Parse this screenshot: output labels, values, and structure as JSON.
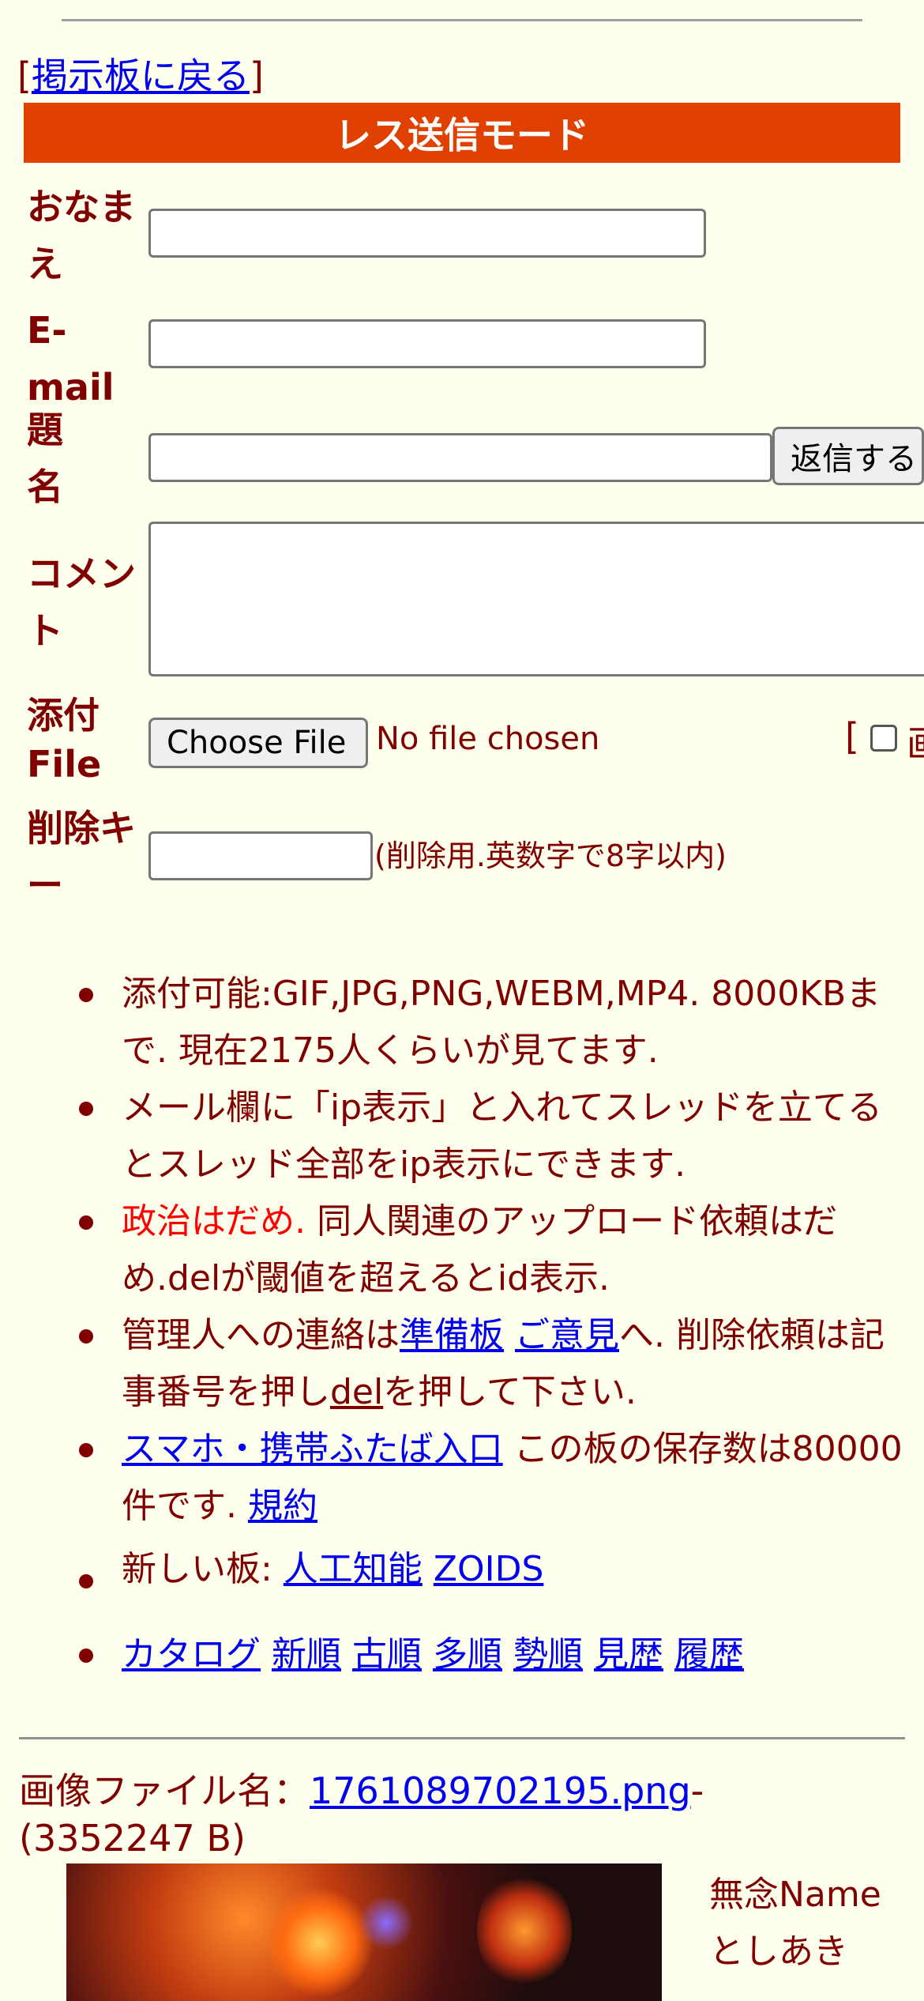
{
  "nav": {
    "bracket_open": "[",
    "back_label": "掲示板に戻る",
    "bracket_close": "]"
  },
  "form": {
    "title": "レス送信モード",
    "name_label": "おなまえ",
    "email_label": "E-mail",
    "subject_label": "題名",
    "submit_label": "返信する",
    "comment_label": "コメント",
    "file_label": "添付File",
    "choose_file_label": "Choose File",
    "no_file_text": "No file chosen",
    "file_option_bracket": "[",
    "file_option_label": "画",
    "delete_key_label": "削除キー",
    "delete_key_hint": "(削除用.英数字で8字以内)",
    "name_value": "",
    "email_value": "",
    "subject_value": "",
    "comment_value": "",
    "delete_key_value": ""
  },
  "rules": {
    "item1": "添付可能:GIF,JPG,PNG,WEBM,MP4. 8000KBまで. 現在2175人くらいが見てます.",
    "item2": "メール欄に「ip表示」と入れてスレッドを立てるとスレッド全部をip表示にできます.",
    "item3_red": "政治はだめ.",
    "item3_rest": " 同人関連のアップロード依頼はだめ.delが閾値を超えるとid表示.",
    "item4_a": "管理人への連絡は",
    "item4_link1": "準備板",
    "item4_link2": "ご意見",
    "item4_b": "へ. 削除依頼は記事番号を押し",
    "item4_link3": "del",
    "item4_c": "を押して下さい.",
    "item5_link": "スマホ・携帯ふたば入口",
    "item5_text": " この板の保存数は80000件です. ",
    "item5_link2": "規約",
    "item6_text": "新しい板: ",
    "item6_link1": "人工知能",
    "item6_link2": "ZOIDS",
    "item7_links": [
      "カタログ",
      "新順",
      "古順",
      "多順",
      "勢順",
      "見歴",
      "履歴"
    ]
  },
  "post": {
    "image_label": "画像ファイル名：",
    "image_file": "1761089702195.png",
    "image_dash": "-",
    "image_size": "(3352247 B)",
    "name_line1": "無念Name",
    "name_line2": "としあき"
  }
}
